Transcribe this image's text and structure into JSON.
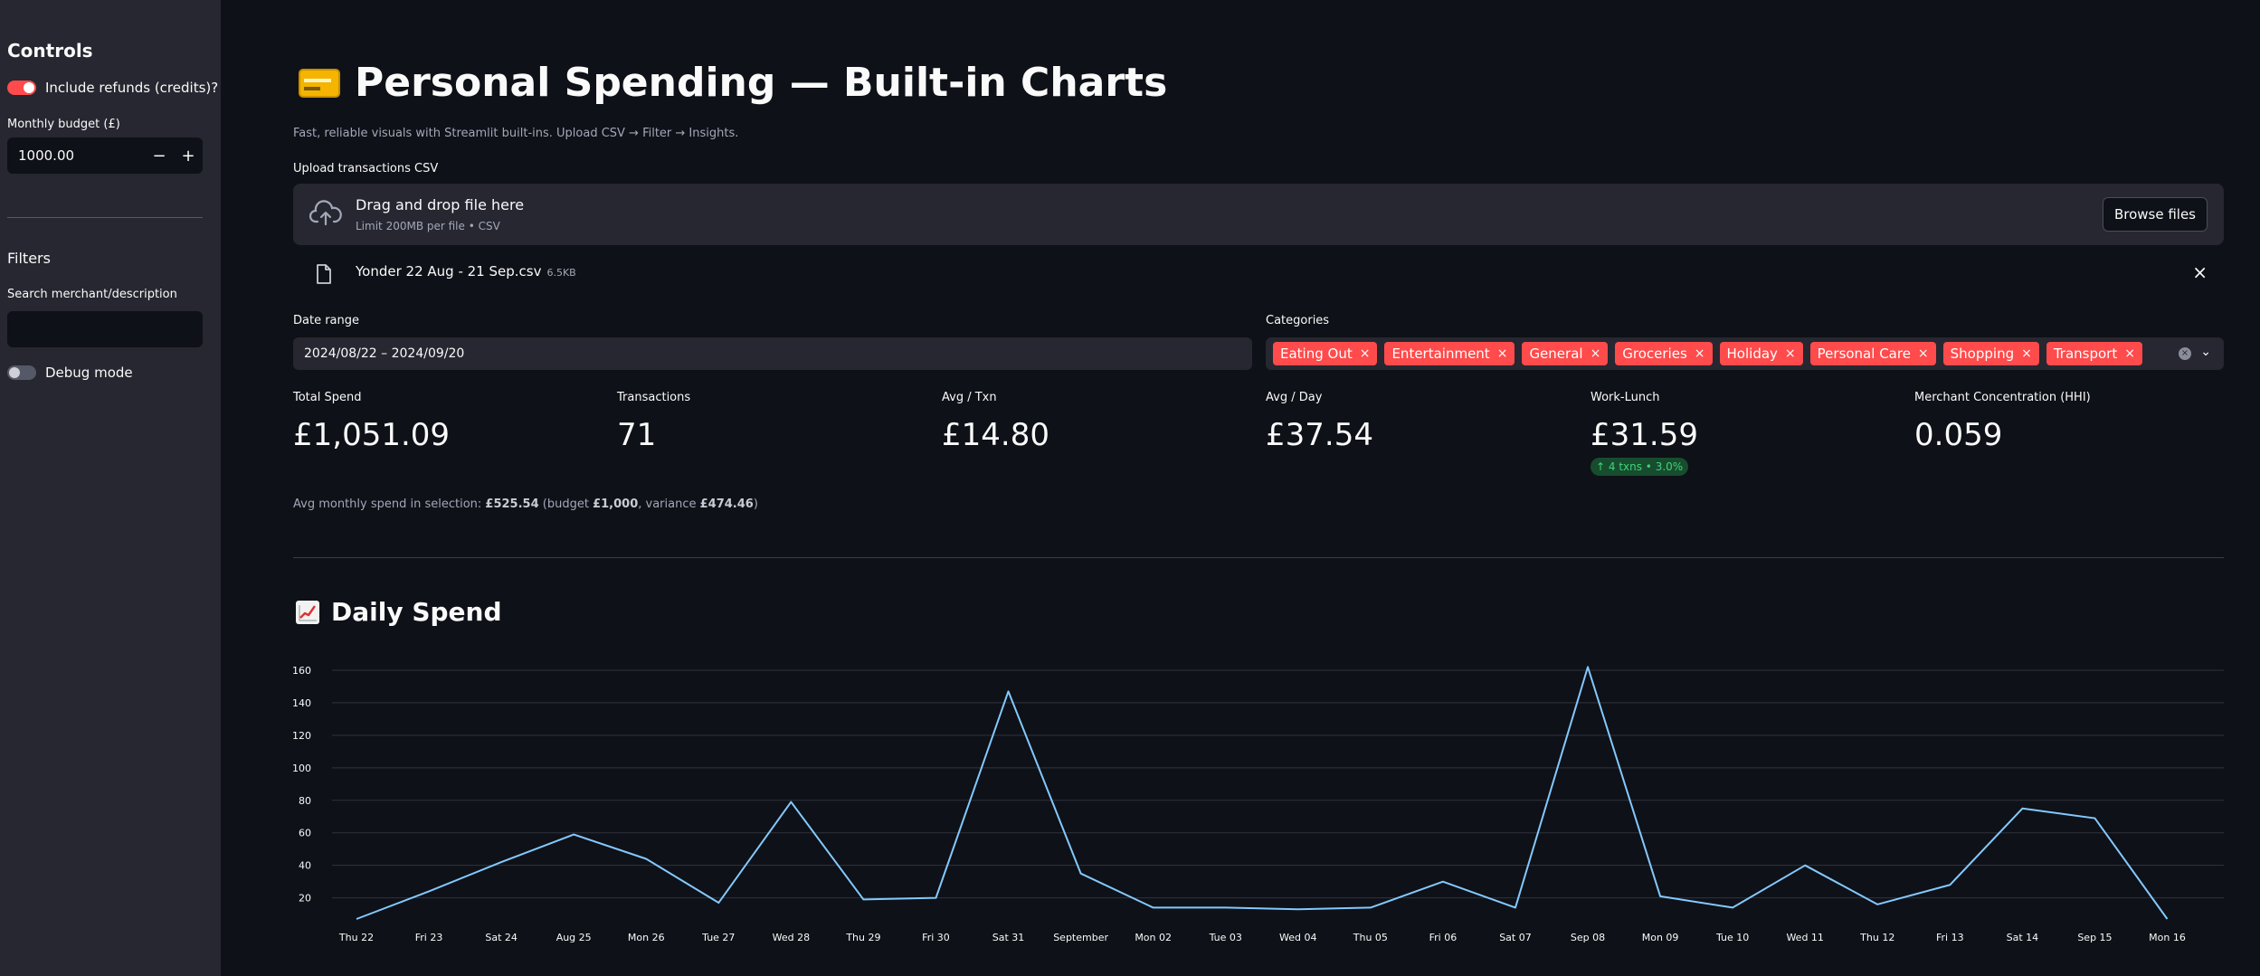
{
  "sidebar": {
    "controls_heading": "Controls",
    "refunds_label": "Include refunds (credits)?",
    "budget_label": "Monthly budget (£)",
    "budget_value": "1000.00",
    "minus": "−",
    "plus": "+",
    "filters_heading": "Filters",
    "search_label": "Search merchant/description",
    "search_value": "",
    "debug_label": "Debug mode"
  },
  "header": {
    "title": "Personal Spending — Built-in Charts",
    "subtitle": "Fast, reliable visuals with Streamlit built-ins. Upload CSV → Filter → Insights."
  },
  "upload": {
    "label": "Upload transactions CSV",
    "drop_title": "Drag and drop file here",
    "drop_sub": "Limit 200MB per file • CSV",
    "browse": "Browse files",
    "file_name": "Yonder 22 Aug - 21 Sep.csv",
    "file_size": "6.5KB",
    "close": "×"
  },
  "filters": {
    "date_label": "Date range",
    "date_value": "2024/08/22 – 2024/09/20",
    "categories_label": "Categories",
    "categories": [
      "Eating Out",
      "Entertainment",
      "General",
      "Groceries",
      "Holiday",
      "Personal Care",
      "Shopping",
      "Transport"
    ]
  },
  "metrics": [
    {
      "label": "Total Spend",
      "value": "£1,051.09"
    },
    {
      "label": "Transactions",
      "value": "71"
    },
    {
      "label": "Avg / Txn",
      "value": "£14.80"
    },
    {
      "label": "Avg / Day",
      "value": "£37.54"
    },
    {
      "label": "Work-Lunch",
      "value": "£31.59"
    },
    {
      "label": "Merchant Concentration (HHI)",
      "value": "0.059"
    }
  ],
  "work_lunch_delta": "↑ 4 txns • 3.0%",
  "caption": {
    "prefix": "Avg monthly spend in selection: ",
    "avg": "£525.54",
    "mid": " (budget ",
    "budget": "£1,000",
    "mid2": ", variance ",
    "variance": "£474.46",
    "suffix": ")"
  },
  "chart_title": "Daily Spend",
  "colors": {
    "accent": "#ff4b4b",
    "line": "#83c9ff",
    "background": "#0e1117",
    "sidebar": "#262730"
  },
  "chart_data": {
    "type": "line",
    "title": "Daily Spend",
    "xlabel": "",
    "ylabel": "",
    "ylim": [
      7,
      165
    ],
    "y_ticks": [
      20,
      40,
      60,
      80,
      100,
      120,
      140,
      160
    ],
    "x_tick_labels": [
      "Thu 22",
      "Fri 23",
      "Sat 24",
      "Aug 25",
      "Mon 26",
      "Tue 27",
      "Wed 28",
      "Thu 29",
      "Fri 30",
      "Sat 31",
      "September",
      "Mon 02",
      "Tue 03",
      "Wed 04",
      "Thu 05",
      "Fri 06",
      "Sat 07",
      "Sep 08",
      "Mon 09",
      "Tue 10",
      "Wed 11",
      "Thu 12",
      "Fri 13",
      "Sat 14",
      "Sep 15",
      "Mon 16"
    ],
    "grid": true,
    "series": [
      {
        "values": [
          7,
          24,
          42,
          59,
          44,
          17,
          79,
          19,
          20,
          147,
          35,
          14,
          14,
          13,
          14,
          30,
          14,
          162,
          21,
          14,
          40,
          16,
          28,
          75,
          69,
          7
        ]
      }
    ]
  }
}
